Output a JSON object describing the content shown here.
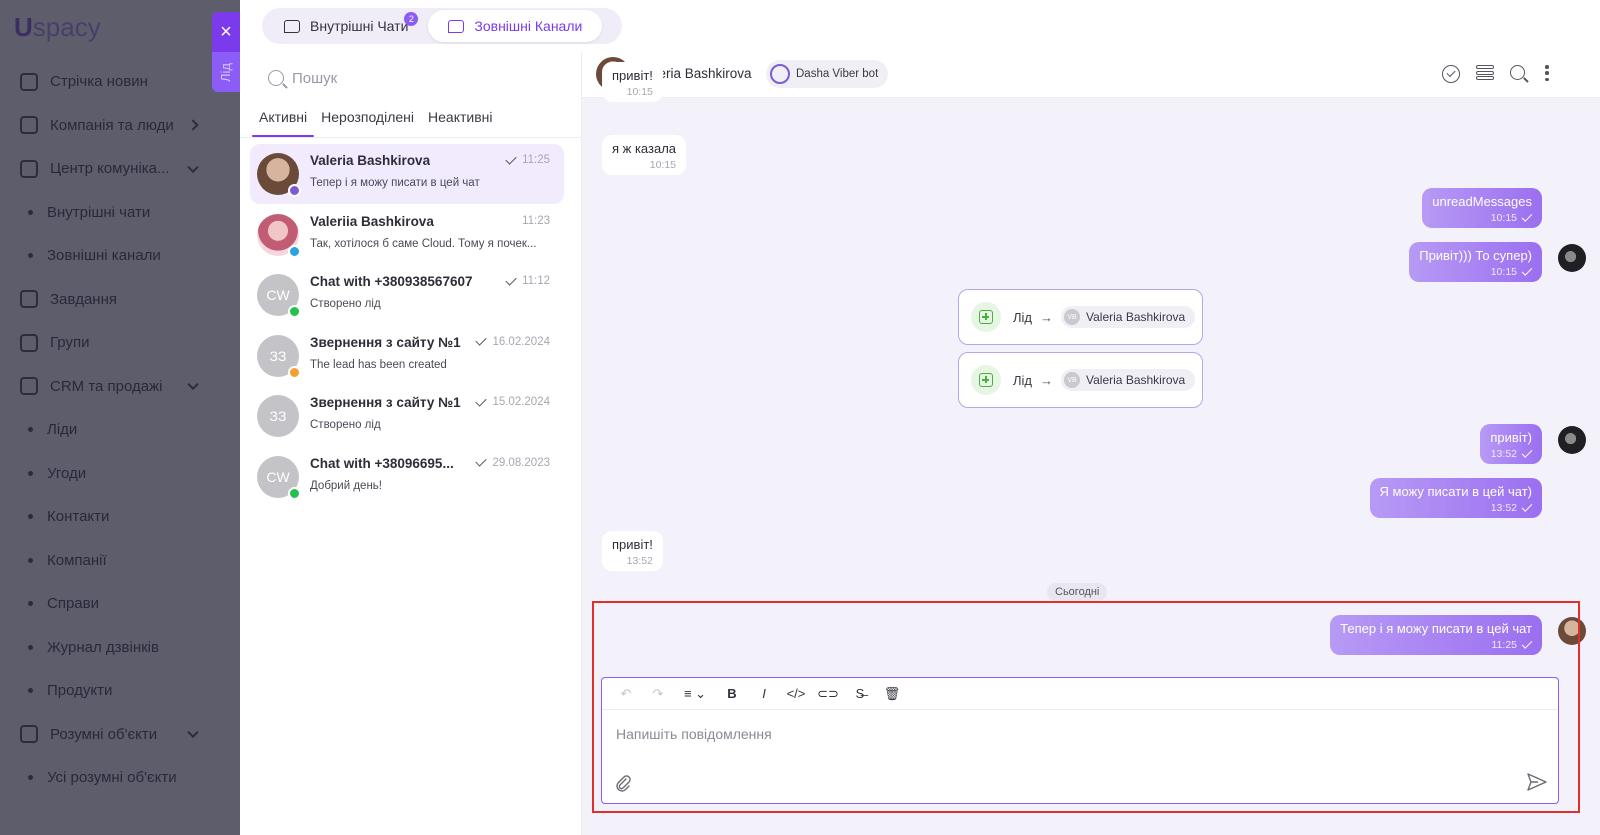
{
  "app": {
    "logo_u": "U",
    "logo_rest": "spacy",
    "close_label": "×",
    "lead_tab": "Лід"
  },
  "background_nav": [
    {
      "label": "Стрічка новин",
      "type": "item"
    },
    {
      "label": "Компанія та люди",
      "type": "item",
      "chevron": "right"
    },
    {
      "label": "Центр комуніка...",
      "type": "item",
      "chevron": "down"
    },
    {
      "label": "Внутрішні чати",
      "type": "sub"
    },
    {
      "label": "Зовнішні канали",
      "type": "sub"
    },
    {
      "label": "Завдання",
      "type": "item"
    },
    {
      "label": "Групи",
      "type": "item"
    },
    {
      "label": "CRM та продажі",
      "type": "item",
      "chevron": "down"
    },
    {
      "label": "Ліди",
      "type": "sub"
    },
    {
      "label": "Угоди",
      "type": "sub"
    },
    {
      "label": "Контакти",
      "type": "sub"
    },
    {
      "label": "Компанії",
      "type": "sub"
    },
    {
      "label": "Справи",
      "type": "sub"
    },
    {
      "label": "Журнал дзвінків",
      "type": "sub"
    },
    {
      "label": "Продукти",
      "type": "sub"
    },
    {
      "label": "Розумні об'єкти",
      "type": "item",
      "chevron": "down"
    },
    {
      "label": "Усі розумні об'єкти",
      "type": "sub"
    }
  ],
  "top_tabs": [
    {
      "label": "Внутрішні Чати",
      "badge": "2",
      "active": false
    },
    {
      "label": "Зовнішні Канали",
      "active": true
    }
  ],
  "search": {
    "placeholder": "Пошук"
  },
  "list_tabs": [
    {
      "label": "Активні",
      "active": true
    },
    {
      "label": "Нерозподілені",
      "active": false
    },
    {
      "label": "Неактивні",
      "active": false
    }
  ],
  "chats": [
    {
      "name": "Valeria Bashkirova",
      "time": "11:25",
      "read": true,
      "preview": "Тепер і я можу писати в цей чат",
      "avatar": "photo1",
      "initials": "",
      "channel": "viber",
      "selected": true
    },
    {
      "name": "Valeriia Bashkirova",
      "time": "11:23",
      "read": false,
      "preview": "Так, хотілося б саме Cloud. Тому я почек...",
      "avatar": "photo2",
      "initials": "",
      "channel": "telegram",
      "selected": false
    },
    {
      "name": "Chat with +380938567607",
      "time": "11:12",
      "read": true,
      "preview": "Створено лід",
      "avatar": "initials",
      "initials": "CW",
      "channel": "whatsapp",
      "selected": false
    },
    {
      "name": "Звернення з сайту №1",
      "time": "16.02.2024",
      "read": true,
      "preview": "The lead has been created",
      "avatar": "initials",
      "initials": "ЗЗ",
      "channel": "site",
      "selected": false
    },
    {
      "name": "Звернення з сайту №1",
      "time": "15.02.2024",
      "read": true,
      "preview": "Створено лід",
      "avatar": "initials",
      "initials": "ЗЗ",
      "channel": "",
      "selected": false
    },
    {
      "name": "Chat with +38096695...",
      "time": "29.08.2023",
      "read": true,
      "preview": "Добрий день!",
      "avatar": "initials",
      "initials": "CW",
      "channel": "whatsapp",
      "selected": false
    }
  ],
  "conversation": {
    "name": "Valeria Bashkirova",
    "bot": "Dasha Viber bot",
    "messages": [
      {
        "dir": "in",
        "text": "привіт!",
        "time": "10:15"
      },
      {
        "dir": "in",
        "text": "я ж казала",
        "time": "10:15"
      },
      {
        "dir": "out",
        "text": "unreadMessages",
        "time": "10:15"
      },
      {
        "dir": "out",
        "text": "Привіт))) То супер)",
        "time": "10:15"
      },
      {
        "dir": "sys",
        "label": "Лід",
        "target": "Valeria Bashkirova",
        "tag": "VB"
      },
      {
        "dir": "sys",
        "label": "Лід",
        "target": "Valeria Bashkirova",
        "tag": "VB"
      },
      {
        "dir": "out",
        "text": "привіт)",
        "time": "13:52"
      },
      {
        "dir": "out",
        "text": "Я можу писати в цей чат)",
        "time": "13:52"
      },
      {
        "dir": "in",
        "text": "привіт!",
        "time": "13:52"
      },
      {
        "dir": "out",
        "text": "Тепер і я можу писати в цей чат",
        "time": "11:25"
      }
    ],
    "today_label": "Сьогодні"
  },
  "composer": {
    "placeholder": "Напишіть повідомлення",
    "value": "",
    "toolbar": [
      {
        "name": "undo-icon",
        "glyph": "↶",
        "disabled": true
      },
      {
        "name": "redo-icon",
        "glyph": "↷",
        "disabled": true
      },
      {
        "name": "align-icon",
        "glyph": "≡ ⌄",
        "disabled": false
      },
      {
        "name": "bold-icon",
        "glyph": "B",
        "disabled": false
      },
      {
        "name": "italic-icon",
        "glyph": "I",
        "disabled": false
      },
      {
        "name": "code-icon",
        "glyph": "</>",
        "disabled": false
      },
      {
        "name": "link-icon",
        "glyph": "⊂⊃",
        "disabled": false
      },
      {
        "name": "strikethrough-icon",
        "glyph": "S̶",
        "disabled": false
      },
      {
        "name": "trash-icon",
        "glyph": "🗑",
        "disabled": false
      }
    ]
  },
  "colors": {
    "accent": "#7c3aed",
    "outgoing_bubble": "#a47ff2",
    "highlight": "#e0302b"
  }
}
